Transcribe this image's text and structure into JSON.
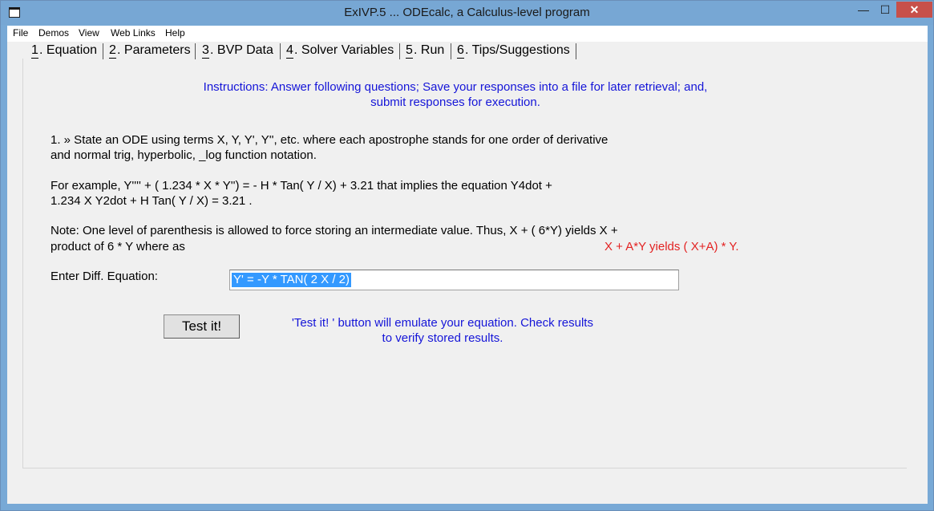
{
  "window": {
    "title": "ExIVP.5 ... ODEcalc, a Calculus-level program",
    "min_glyph": "—",
    "max_glyph": "☐",
    "close_glyph": "✕"
  },
  "menu": {
    "items": [
      "File",
      "Demos",
      "View",
      "Web Links",
      "Help"
    ]
  },
  "tabs": [
    {
      "number": "1",
      "label": ". Equation",
      "active": true
    },
    {
      "number": "2",
      "label": ". Parameters"
    },
    {
      "number": "3",
      "label": ". BVP Data"
    },
    {
      "number": "4",
      "label": ". Solver Variables"
    },
    {
      "number": "5",
      "label": ". Run"
    },
    {
      "number": "6",
      "label": ". Tips/Suggestions"
    }
  ],
  "instructions": {
    "line1": "Instructions: Answer following questions; Save your responses into a file for later retrieval; and,",
    "line2": "submit responses for execution."
  },
  "question": {
    "line1": "1. » State an ODE  using terms X, Y, Y', Y'', etc. where each apostrophe stands for one order of derivative",
    "line2": "and normal trig, hyperbolic, _log function notation."
  },
  "example": {
    "line1": "For example, Y''''  +  ( 1.234 * X  *  Y'')  =  - H * Tan( Y / X) + 3.21 that implies the equation    Y4dot +",
    "line2": "1.234 X Y2dot    +    H Tan( Y / X)    = 3.21 ."
  },
  "note": {
    "line1": "Note: One level of parenthesis is allowed to force storing an intermediate value. Thus, X + ( 6*Y) yields X +",
    "line2": "product of 6 * Y where as",
    "red": "X + A*Y yields ( X+A) * Y."
  },
  "equation": {
    "label": "Enter Diff. Equation:",
    "value": "Y' = -Y * TAN( 2 X / 2)"
  },
  "test_button": {
    "label": "Test it!"
  },
  "hint": {
    "line1": "'Test it! ' button will emulate your equation.  Check results",
    "line2": "to verify stored results."
  }
}
